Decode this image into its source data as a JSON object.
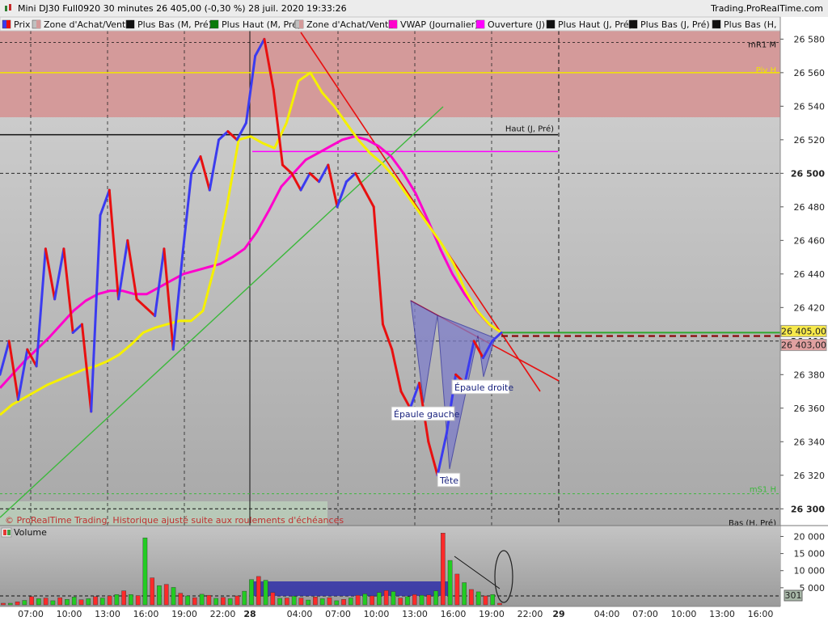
{
  "window": {
    "title": "Mini DJ30 Full0920 30 minutes 26 405,00 (-0,30 %) 28 juil. 2020 19:33:26",
    "brand": "Trading.ProRealTime.com"
  },
  "colors": {
    "prix": "#3b3bf0",
    "red_line": "#e81010",
    "vwap": "#ff00cc",
    "ouverture": "#ff00ff",
    "yellow_ma": "#f5f000",
    "zone": "#d49a9a",
    "green_trend": "#3cb83c",
    "pattern_fill": "#7d7dc9"
  },
  "legend": [
    {
      "label": "Prix",
      "color": "#3b3bf0",
      "accent": "#e81010"
    },
    {
      "label": "Zone d'Achat/Vente",
      "color": "#c0c0c0",
      "accent": "#d49a9a"
    },
    {
      "label": "Plus Bas (M, Pré)",
      "color": "#111111",
      "accent": "#111111"
    },
    {
      "label": "Plus Haut (M, Pré)",
      "color": "#0a7a0a",
      "accent": "#0a7a0a"
    },
    {
      "label": "Zone d'Achat/Vente",
      "color": "#c0c0c0",
      "accent": "#d49a9a"
    },
    {
      "label": "VWAP (Journalier)",
      "color": "#ff00cc",
      "accent": "#ff00cc"
    },
    {
      "label": "Ouverture (J)",
      "color": "#ff00ff",
      "accent": "#ff00ff"
    },
    {
      "label": "Plus Haut (J, Pré)",
      "color": "#111111",
      "accent": "#111111"
    },
    {
      "label": "Plus Bas (J, Pré)",
      "color": "#111111",
      "accent": "#111111"
    },
    {
      "label": "Plus Bas (H, P",
      "color": "#111111",
      "accent": "#111111"
    }
  ],
  "chart_data": [
    {
      "type": "line",
      "title": "Mini DJ30 Full0920 30 minutes",
      "ylim": [
        26290,
        26585
      ],
      "y_ticks": [
        "26 580",
        "26 560",
        "26 540",
        "26 520",
        "26 500",
        "26 480",
        "26 460",
        "26 440",
        "26 420",
        "26 400",
        "26 380",
        "26 360",
        "26 340",
        "26 320",
        "26 300"
      ],
      "x_ticks": [
        "07:00",
        "10:00",
        "13:00",
        "16:00",
        "19:00",
        "22:00",
        "28",
        "04:00",
        "07:00",
        "10:00",
        "13:00",
        "16:00",
        "19:00",
        "22:00",
        "29",
        "04:00",
        "07:00",
        "10:00",
        "13:00",
        "16:00"
      ],
      "price_last": "26 405,00",
      "price_ref": "26 403,00",
      "series": [
        {
          "name": "Prix",
          "values": [
            26380,
            26400,
            26365,
            26395,
            26385,
            26455,
            26425,
            26455,
            26405,
            26410,
            26358,
            26475,
            26490,
            26425,
            26460,
            26425,
            26420,
            26415,
            26455,
            26395,
            26450,
            26500,
            26510,
            26490,
            26520,
            26525,
            26520,
            26530,
            26570,
            26580,
            26550,
            26505,
            26500,
            26490,
            26500,
            26495,
            26505,
            26480,
            26495,
            26500,
            26490,
            26480,
            26410,
            26395,
            26370,
            26360,
            26375,
            26340,
            26320,
            26345,
            26380,
            26375,
            26400,
            26390,
            26400,
            26405
          ]
        },
        {
          "name": "Ouverture (J)",
          "values": [
            26356,
            26362,
            26366,
            26370,
            26374,
            26377,
            26380,
            26383,
            26385,
            26388,
            26392,
            26398,
            26405,
            26408,
            26410,
            26412,
            26412,
            26418,
            26445,
            26480,
            26520,
            26522,
            26518,
            26515,
            26530,
            26555,
            26560,
            26548,
            26540,
            26530,
            26520,
            26512,
            26506,
            26498,
            26488,
            26478,
            26468,
            26458,
            26446,
            26430,
            26418,
            26410,
            26405
          ]
        },
        {
          "name": "VWAP (Journalier)",
          "values": [
            26372,
            26380,
            26388,
            26395,
            26402,
            26410,
            26418,
            26424,
            26428,
            26430,
            26430,
            26428,
            26428,
            26432,
            26436,
            26440,
            26442,
            26444,
            26446,
            26450,
            26455,
            26465,
            26478,
            26492,
            26500,
            26508,
            26512,
            26516,
            26520,
            26522,
            26520,
            26516,
            26510,
            26500,
            26488,
            26472,
            26455,
            26440,
            26428,
            26418,
            26410,
            26405
          ]
        }
      ],
      "annotations": [
        "Épaule gauche",
        "Tête",
        "Épaule droite"
      ],
      "levels": [
        {
          "label": "mR1 M",
          "value": 26578
        },
        {
          "label": "Piv H",
          "value": 26560
        },
        {
          "label": "Haut (J, Pré)",
          "value": 26523
        },
        {
          "label": "mS1 H",
          "value": 26309
        },
        {
          "label": "Bas (H, Pré)",
          "value": 26288
        }
      ],
      "note": "© ProRealTime Trading. Historique ajusté suite aux roulements d'échéances"
    },
    {
      "type": "bar",
      "title": "Volume",
      "ylim": [
        0,
        22000
      ],
      "y_ticks": [
        "20 000",
        "15 000",
        "10 000",
        "5 000"
      ],
      "last_value": "301",
      "values": [
        200,
        400,
        900,
        1300,
        2400,
        1800,
        2000,
        1200,
        2100,
        1600,
        2300,
        1500,
        1800,
        2400,
        2000,
        2600,
        3000,
        4100,
        3000,
        2700,
        19600,
        7900,
        5600,
        6000,
        5100,
        3400,
        2600,
        2100,
        3100,
        2800,
        1900,
        2200,
        1800,
        2600,
        4000,
        7400,
        8300,
        7200,
        3600,
        1900,
        2000,
        2500,
        2000,
        1400,
        2300,
        1800,
        2100,
        1200,
        1600,
        2000,
        2800,
        3200,
        2600,
        3600,
        4200,
        3900,
        2000,
        2400,
        3000,
        2800,
        2900,
        4100,
        21000,
        13000,
        9000,
        6500,
        4500,
        3800,
        2600,
        3000,
        301
      ],
      "colors": [
        "r",
        "g",
        "r",
        "g",
        "r",
        "g",
        "r",
        "g",
        "r",
        "g",
        "g",
        "r",
        "g",
        "r",
        "g",
        "r",
        "g",
        "r",
        "g",
        "r",
        "g",
        "r",
        "g",
        "r",
        "g",
        "r",
        "g",
        "r",
        "g",
        "r",
        "g",
        "r",
        "g",
        "r",
        "g",
        "g",
        "r",
        "g",
        "r",
        "g",
        "r",
        "g",
        "r",
        "g",
        "r",
        "g",
        "r",
        "g",
        "r",
        "g",
        "r",
        "g",
        "r",
        "g",
        "r",
        "g",
        "r",
        "g",
        "r",
        "g",
        "r",
        "g",
        "r",
        "g",
        "r",
        "g",
        "r",
        "g",
        "r",
        "g",
        "r"
      ]
    }
  ]
}
